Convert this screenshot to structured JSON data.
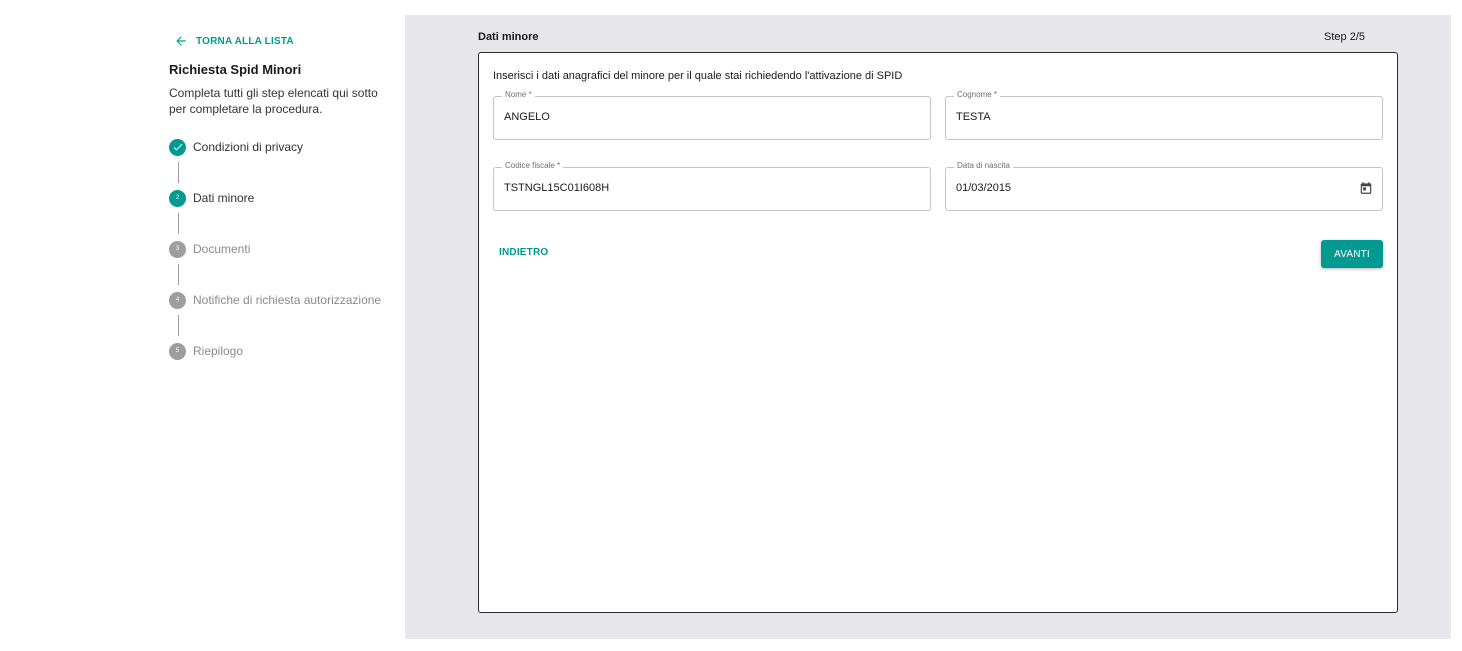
{
  "sidebar": {
    "back_label": "TORNA ALLA LISTA",
    "title": "Richiesta Spid Minori",
    "description": "Completa tutti gli step elencati qui sotto per completare la procedura.",
    "steps": [
      {
        "number": "1",
        "label": "Condizioni di privacy",
        "state": "done"
      },
      {
        "number": "2",
        "label": "Dati minore",
        "state": "active"
      },
      {
        "number": "3",
        "label": "Documenti",
        "state": "todo"
      },
      {
        "number": "4",
        "label": "Notifiche di richiesta autorizzazione",
        "state": "todo"
      },
      {
        "number": "5",
        "label": "Riepilogo",
        "state": "todo"
      }
    ]
  },
  "main": {
    "title": "Dati minore",
    "step_indicator": "Step 2/5",
    "intro": "Inserisci i dati anagrafici del minore per il quale stai richiedendo l'attivazione di SPID",
    "fields": {
      "nome": {
        "label": "Nome *",
        "value": "ANGELO"
      },
      "cognome": {
        "label": "Cognome *",
        "value": "TESTA"
      },
      "codice_fiscale": {
        "label": "Codice fiscale *",
        "value": "TSTNGL15C01I608H"
      },
      "data_nascita": {
        "label": "Data di nascita",
        "value": "01/03/2015"
      }
    },
    "back_button": "INDIETRO",
    "next_button": "AVANTI"
  },
  "colors": {
    "accent": "#009a93",
    "panel_bg": "#e7e7eb",
    "inactive_step": "#9e9e9e"
  },
  "icons": {
    "back": "arrow-left-icon",
    "done_step": "check-icon",
    "date": "calendar-icon"
  }
}
